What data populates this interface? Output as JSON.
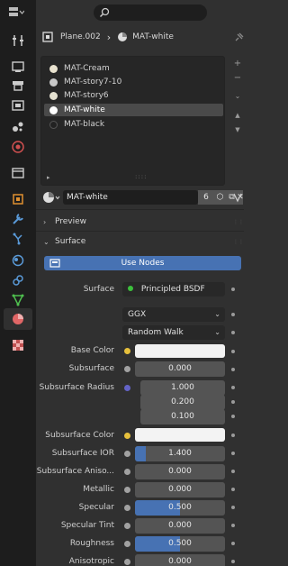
{
  "header": {
    "editor_icon": "properties-editor-icon",
    "search_placeholder": ""
  },
  "breadcrumb": {
    "object": "Plane.002",
    "separator": "›",
    "material": "MAT-white"
  },
  "slots": [
    {
      "label": "MAT-Cream",
      "color": "#e8e2cf"
    },
    {
      "label": "MAT-story7-10",
      "color": "#c8c8c8"
    },
    {
      "label": "MAT-story6",
      "color": "#e4e0d0"
    },
    {
      "label": "MAT-white",
      "color": "#ffffff",
      "selected": true
    },
    {
      "label": "MAT-black",
      "color": "#222222"
    }
  ],
  "material_selector": {
    "name": "MAT-white",
    "users": "6",
    "fake_user": "⬡",
    "duplicate": "⧉",
    "unlink": "✕"
  },
  "panels": {
    "preview": "Preview",
    "surface": "Surface"
  },
  "use_nodes": "Use Nodes",
  "surface": {
    "label": "Surface",
    "shader": "Principled BSDF",
    "distribution": "GGX",
    "subsurface_method": "Random Walk"
  },
  "props": [
    {
      "label": "Base Color",
      "type": "color",
      "socket": "#e6c03c"
    },
    {
      "label": "Subsurface",
      "type": "number",
      "value": "0.000",
      "fill": 0,
      "socket": "#a1a1a1"
    },
    {
      "label": "Subsurface Radius",
      "type": "vector",
      "values": [
        "1.000",
        "0.200",
        "0.100"
      ],
      "socket": "#6363c7"
    },
    {
      "label": "Subsurface Color",
      "type": "color",
      "socket": "#e6c03c"
    },
    {
      "label": "Subsurface IOR",
      "type": "number",
      "value": "1.400",
      "fill": 0.12,
      "socket": "#a1a1a1"
    },
    {
      "label": "Subsurface Aniso...",
      "type": "number",
      "value": "0.000",
      "fill": 0,
      "socket": "#a1a1a1"
    },
    {
      "label": "Metallic",
      "type": "number",
      "value": "0.000",
      "fill": 0,
      "socket": "#a1a1a1"
    },
    {
      "label": "Specular",
      "type": "number",
      "value": "0.500",
      "fill": 0.5,
      "socket": "#a1a1a1"
    },
    {
      "label": "Specular Tint",
      "type": "number",
      "value": "0.000",
      "fill": 0,
      "socket": "#a1a1a1"
    },
    {
      "label": "Roughness",
      "type": "number",
      "value": "0.500",
      "fill": 0.5,
      "socket": "#a1a1a1"
    },
    {
      "label": "Anisotropic",
      "type": "number",
      "value": "0.000",
      "fill": 0,
      "socket": "#a1a1a1"
    }
  ],
  "colors": {
    "accent": "#4772b3",
    "material_tab_icon": "#e06666",
    "panel_bg": "#303030",
    "strip_bg": "#1d1d1d"
  }
}
